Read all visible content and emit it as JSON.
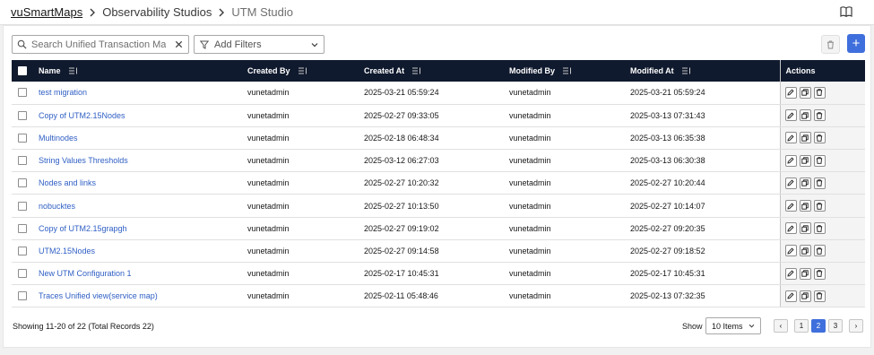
{
  "breadcrumb": {
    "root": "vuSmartMaps",
    "section": "Observability Studios",
    "current": "UTM Studio"
  },
  "toolbar": {
    "search_placeholder": "Search Unified Transaction Maps",
    "filters_label": "Add Filters",
    "add_label": "+"
  },
  "table": {
    "headers": {
      "name": "Name",
      "created_by": "Created By",
      "created_at": "Created At",
      "modified_by": "Modified By",
      "modified_at": "Modified At",
      "actions": "Actions"
    },
    "rows": [
      {
        "name": "test migration",
        "created_by": "vunetadmin",
        "created_at": "2025-03-21 05:59:24",
        "modified_by": "vunetadmin",
        "modified_at": "2025-03-21 05:59:24"
      },
      {
        "name": "Copy of UTM2.15Nodes",
        "created_by": "vunetadmin",
        "created_at": "2025-02-27 09:33:05",
        "modified_by": "vunetadmin",
        "modified_at": "2025-03-13 07:31:43"
      },
      {
        "name": "Multinodes",
        "created_by": "vunetadmin",
        "created_at": "2025-02-18 06:48:34",
        "modified_by": "vunetadmin",
        "modified_at": "2025-03-13 06:35:38"
      },
      {
        "name": "String Values Thresholds",
        "created_by": "vunetadmin",
        "created_at": "2025-03-12 06:27:03",
        "modified_by": "vunetadmin",
        "modified_at": "2025-03-13 06:30:38"
      },
      {
        "name": "Nodes and links",
        "created_by": "vunetadmin",
        "created_at": "2025-02-27 10:20:32",
        "modified_by": "vunetadmin",
        "modified_at": "2025-02-27 10:20:44"
      },
      {
        "name": "nobucktes",
        "created_by": "vunetadmin",
        "created_at": "2025-02-27 10:13:50",
        "modified_by": "vunetadmin",
        "modified_at": "2025-02-27 10:14:07"
      },
      {
        "name": "Copy of UTM2.15grapgh",
        "created_by": "vunetadmin",
        "created_at": "2025-02-27 09:19:02",
        "modified_by": "vunetadmin",
        "modified_at": "2025-02-27 09:20:35"
      },
      {
        "name": "UTM2.15Nodes",
        "created_by": "vunetadmin",
        "created_at": "2025-02-27 09:14:58",
        "modified_by": "vunetadmin",
        "modified_at": "2025-02-27 09:18:52"
      },
      {
        "name": "New UTM Configuration 1",
        "created_by": "vunetadmin",
        "created_at": "2025-02-17 10:45:31",
        "modified_by": "vunetadmin",
        "modified_at": "2025-02-17 10:45:31"
      },
      {
        "name": "Traces Unified view(service map)",
        "created_by": "vunetadmin",
        "created_at": "2025-02-11 05:48:46",
        "modified_by": "vunetadmin",
        "modified_at": "2025-02-13 07:32:35"
      }
    ]
  },
  "footer": {
    "records_text": "Showing 11-20 of 22 (Total Records 22)",
    "show_label": "Show",
    "items_per_page": "10 Items",
    "pages": [
      "1",
      "2",
      "3"
    ],
    "current_page": "2",
    "prev_label": "‹",
    "next_label": "›"
  },
  "colors": {
    "header_bg": "#101a2e",
    "link": "#2f5fc4",
    "primary": "#3f6fdc"
  }
}
